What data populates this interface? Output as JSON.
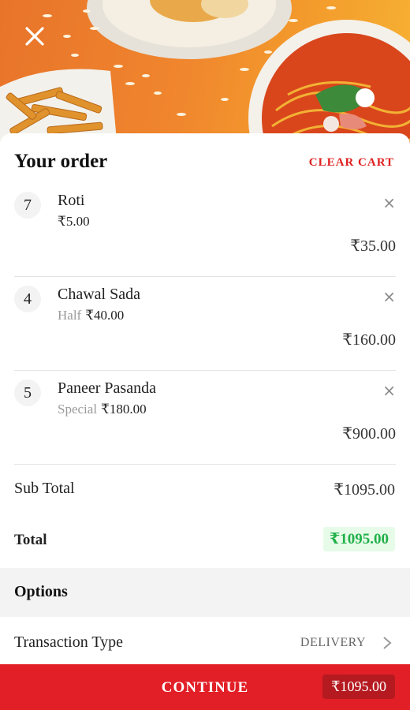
{
  "header": {
    "title": "Your order",
    "clear_label": "CLEAR CART"
  },
  "items": [
    {
      "qty": "7",
      "name": "Roti",
      "variant": "",
      "unit_price": "₹5.00",
      "total": "₹35.00"
    },
    {
      "qty": "4",
      "name": "Chawal Sada",
      "variant": "Half",
      "unit_price": "₹40.00",
      "total": "₹160.00"
    },
    {
      "qty": "5",
      "name": "Paneer Pasanda",
      "variant": "Special",
      "unit_price": "₹180.00",
      "total": "₹900.00"
    }
  ],
  "summary": {
    "subtotal_label": "Sub Total",
    "subtotal": "₹1095.00",
    "total_label": "Total",
    "total": "₹1095.00"
  },
  "options": {
    "heading": "Options",
    "transaction_label": "Transaction Type",
    "transaction_value": "DELIVERY"
  },
  "footer": {
    "continue_label": "CONTINUE",
    "amount": "₹1095.00"
  },
  "icons": {
    "close": "close-icon",
    "remove": "remove-icon",
    "chevron": "chevron-right-icon"
  },
  "colors": {
    "accent": "#e21f26",
    "total_green": "#21b04a",
    "hero_orange": "#f0862e"
  }
}
